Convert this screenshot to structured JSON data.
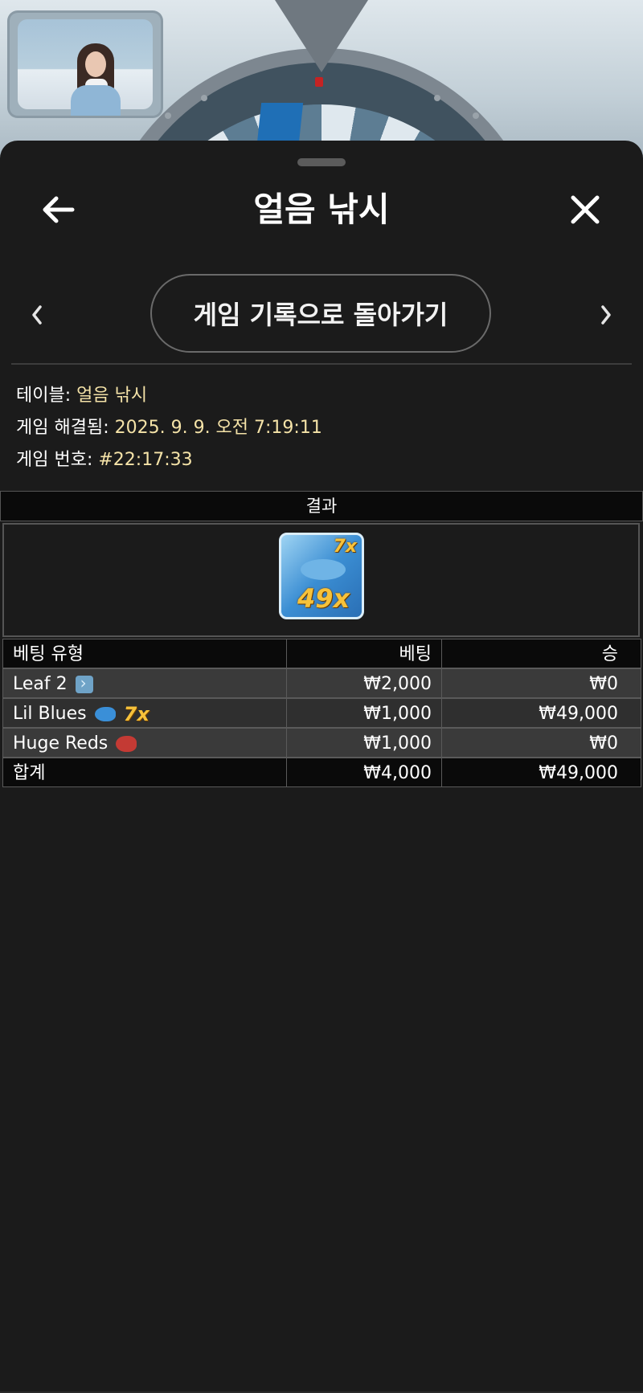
{
  "header": {
    "title": "얼음 낚시",
    "back_icon": "arrow-left-icon",
    "close_icon": "close-icon"
  },
  "navigation": {
    "history_button_label": "게임 기록으로 돌아가기",
    "prev_icon": "chevron-left-icon",
    "next_icon": "chevron-right-icon"
  },
  "info": {
    "table_label": "테이블:",
    "table_value": "얼음 낚시",
    "resolved_label": "게임 해결됨:",
    "resolved_value": "2025. 9. 9. 오전 7:19:11",
    "game_number_label": "게임 번호:",
    "game_number_value": "#22:17:33"
  },
  "result": {
    "header": "결과",
    "tile_multiplier_top": "7x",
    "tile_multiplier_bottom": "49x",
    "tile_icon": "blue-fish-tile-icon"
  },
  "bets_table": {
    "columns": [
      "베팅 유형",
      "베팅",
      "승"
    ],
    "rows": [
      {
        "type": "Leaf 2",
        "icon": "leaf-icon",
        "multiplier": "",
        "bet": "₩2,000",
        "win": "₩0"
      },
      {
        "type": "Lil Blues",
        "icon": "blue-fish-icon",
        "multiplier": "7x",
        "bet": "₩1,000",
        "win": "₩49,000"
      },
      {
        "type": "Huge Reds",
        "icon": "red-fish-icon",
        "multiplier": "",
        "bet": "₩1,000",
        "win": "₩0"
      }
    ],
    "total": {
      "label": "합계",
      "bet": "₩4,000",
      "win": "₩49,000"
    }
  },
  "colors": {
    "sheet_background": "#1b1b1b",
    "value_text": "#f5e3a8",
    "multiplier_gold": "#f7c23a"
  }
}
